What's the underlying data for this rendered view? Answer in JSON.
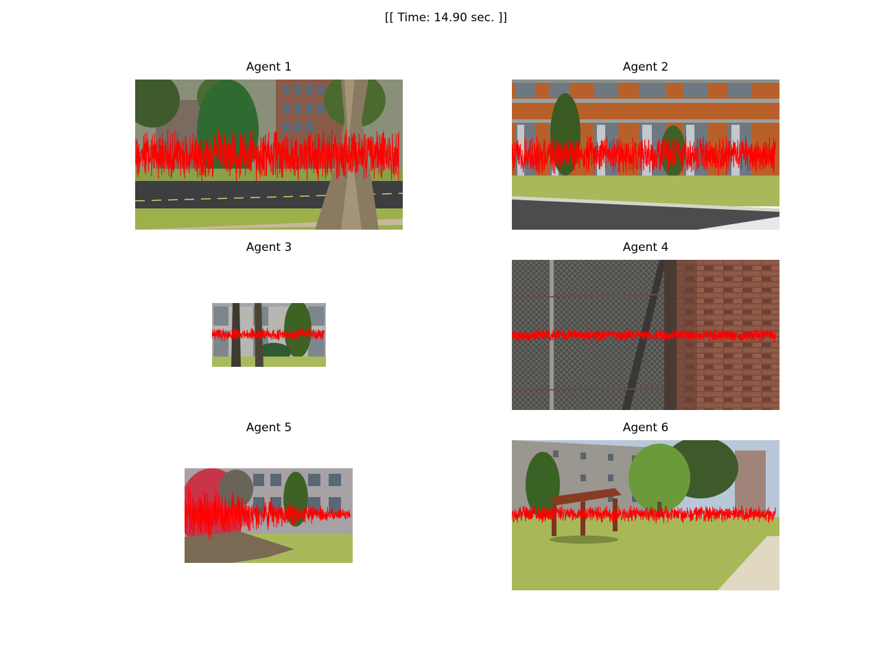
{
  "header": {
    "time_label": "[[ Time: 14.90 sec. ]]"
  },
  "agents": [
    {
      "title": "Agent 1",
      "waveform_amplitude": 0.6
    },
    {
      "title": "Agent 2",
      "waveform_amplitude": 0.45
    },
    {
      "title": "Agent 3",
      "waveform_amplitude": 0.35
    },
    {
      "title": "Agent 4",
      "waveform_amplitude": 0.15
    },
    {
      "title": "Agent 5",
      "waveform_amplitude": 1.0
    },
    {
      "title": "Agent 6",
      "waveform_amplitude": 0.2
    }
  ],
  "colors": {
    "waveform": "#ff0000",
    "background": "#ffffff"
  }
}
